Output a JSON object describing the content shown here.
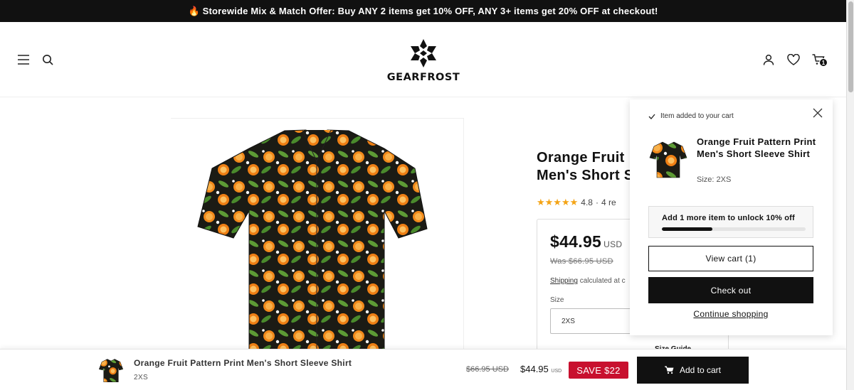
{
  "announcement": {
    "text": "🔥 Storewide Mix & Match Offer: Buy ANY 2 items get 10% OFF, ANY 3+ items get 20% OFF at checkout!"
  },
  "header": {
    "logo_text": "GEARFROST",
    "cart_count": "1",
    "icons": [
      "menu-icon",
      "search-icon",
      "account-icon",
      "heart-icon",
      "cart-icon"
    ]
  },
  "product": {
    "title": "Orange Fruit Pattern Print Men's Short Sleeve Shirt",
    "title_visible": "Orange Fruit\nMen's Short S",
    "rating_value": "4.8",
    "rating_sep": "·",
    "reviews_text": "4 re",
    "price": "$44.95",
    "currency": "USD",
    "was_price": "Was $66.95 USD",
    "shipping_link": "Shipping",
    "shipping_text": " calculated at c",
    "size_label": "Size",
    "size_value": "2XS",
    "size_guide_peek": "Size Guide"
  },
  "cart_drawer": {
    "added_text": "Item added to your cart",
    "item_title": "Orange Fruit Pattern Print Men's Short Sleeve Shirt",
    "item_size": "Size: 2XS",
    "unlock_text": "Add 1 more item to unlock 10% off",
    "progress": 0.35,
    "view_cart": "View cart (1)",
    "checkout": "Check out",
    "continue": "Continue shopping"
  },
  "sticky_bar": {
    "title": "Orange Fruit Pattern Print Men's Short Sleeve Shirt",
    "size": "2XS",
    "was_price": "$66.95 USD",
    "price": "$44.95",
    "currency": "USD",
    "save": "SAVE $22",
    "add_to_cart": "Add to cart"
  },
  "colors": {
    "accent_dark": "#111111",
    "save_red": "#c8102e",
    "star": "#f4a416"
  }
}
